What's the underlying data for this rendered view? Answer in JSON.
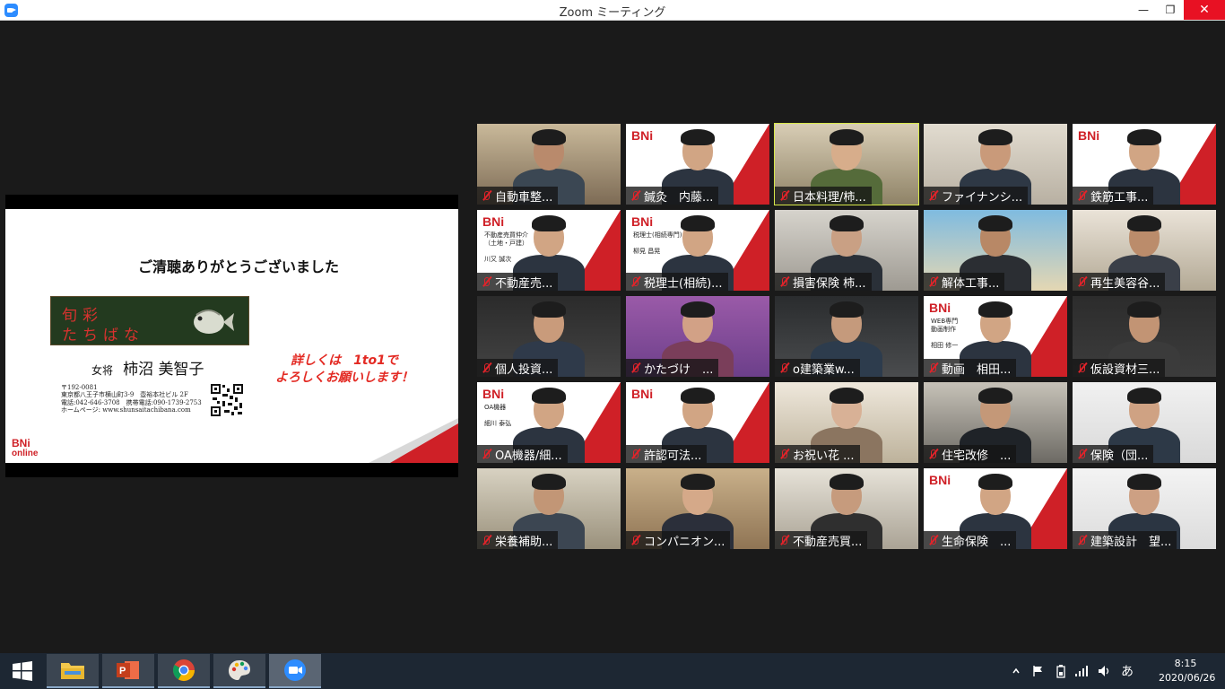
{
  "window": {
    "title": "Zoom ミーティング",
    "min": "—",
    "max": "❐",
    "close": "✕"
  },
  "slide": {
    "title": "ご清聴ありがとうございました",
    "shop_name_line1": "旬彩",
    "shop_name_line2": "たちばな",
    "owner_role": "女将",
    "owner_name": "柿沼 美智子",
    "address": [
      "〒192-0081",
      "東京都八王子市横山町3-9　壺裕本社ビル 2F",
      "電話:042-646-3708　携帯電話:090-1739-2753",
      "ホームページ: www.shunsaitachibana.com"
    ],
    "promo_line1": "詳しくは　1to1で",
    "promo_line2": "よろしくお願いします！",
    "brand": "BNi",
    "brand_sub": "online"
  },
  "participants": [
    {
      "label": "自動車整...",
      "style": "room"
    },
    {
      "label": "鍼灸　内藤...",
      "style": "bni"
    },
    {
      "label": "日本料理/柿...",
      "style": "kitchen",
      "active": true
    },
    {
      "label": "ファイナンシ...",
      "style": "office"
    },
    {
      "label": "鉄筋工事...",
      "style": "bni"
    },
    {
      "label": "不動産売...",
      "style": "bni",
      "card": "不動産売買仲介\n（土地・戸建）\n\n川又 誠次"
    },
    {
      "label": "税理士(相続)...",
      "style": "bni",
      "card": "税理士(相続専門)\n\n柳見 昌晃"
    },
    {
      "label": "損害保険 柿...",
      "style": "office2"
    },
    {
      "label": "解体工事...",
      "style": "beach"
    },
    {
      "label": "再生美容谷...",
      "style": "window"
    },
    {
      "label": "個人投資...",
      "style": "dark"
    },
    {
      "label": "かたづけ　...",
      "style": "flowers"
    },
    {
      "label": "o建築業w...",
      "style": "darkroom"
    },
    {
      "label": "動画　相田...",
      "style": "bni",
      "card": "WEB専門\n動画制作\n\n相田 修一"
    },
    {
      "label": "仮設資材三...",
      "style": "dark2"
    },
    {
      "label": "OA機器/細...",
      "style": "bni",
      "card": "OA機器\n\n細川 泰弘"
    },
    {
      "label": "許認可法...",
      "style": "bni"
    },
    {
      "label": "お祝い花 ...",
      "style": "shelf"
    },
    {
      "label": "住宅改修　...",
      "style": "office3"
    },
    {
      "label": "保険（団...",
      "style": "white"
    },
    {
      "label": "栄養補助...",
      "style": "office4"
    },
    {
      "label": "コンパニオン...",
      "style": "japanese"
    },
    {
      "label": "不動産売買...",
      "style": "office5"
    },
    {
      "label": "生命保険　...",
      "style": "bni"
    },
    {
      "label": "建築設計　望...",
      "style": "white2"
    }
  ],
  "taskbar": {
    "apps": [
      "explorer",
      "powerpoint",
      "chrome",
      "paint",
      "zoom"
    ],
    "ime": "あ",
    "time": "8:15",
    "date": "2020/06/26"
  }
}
